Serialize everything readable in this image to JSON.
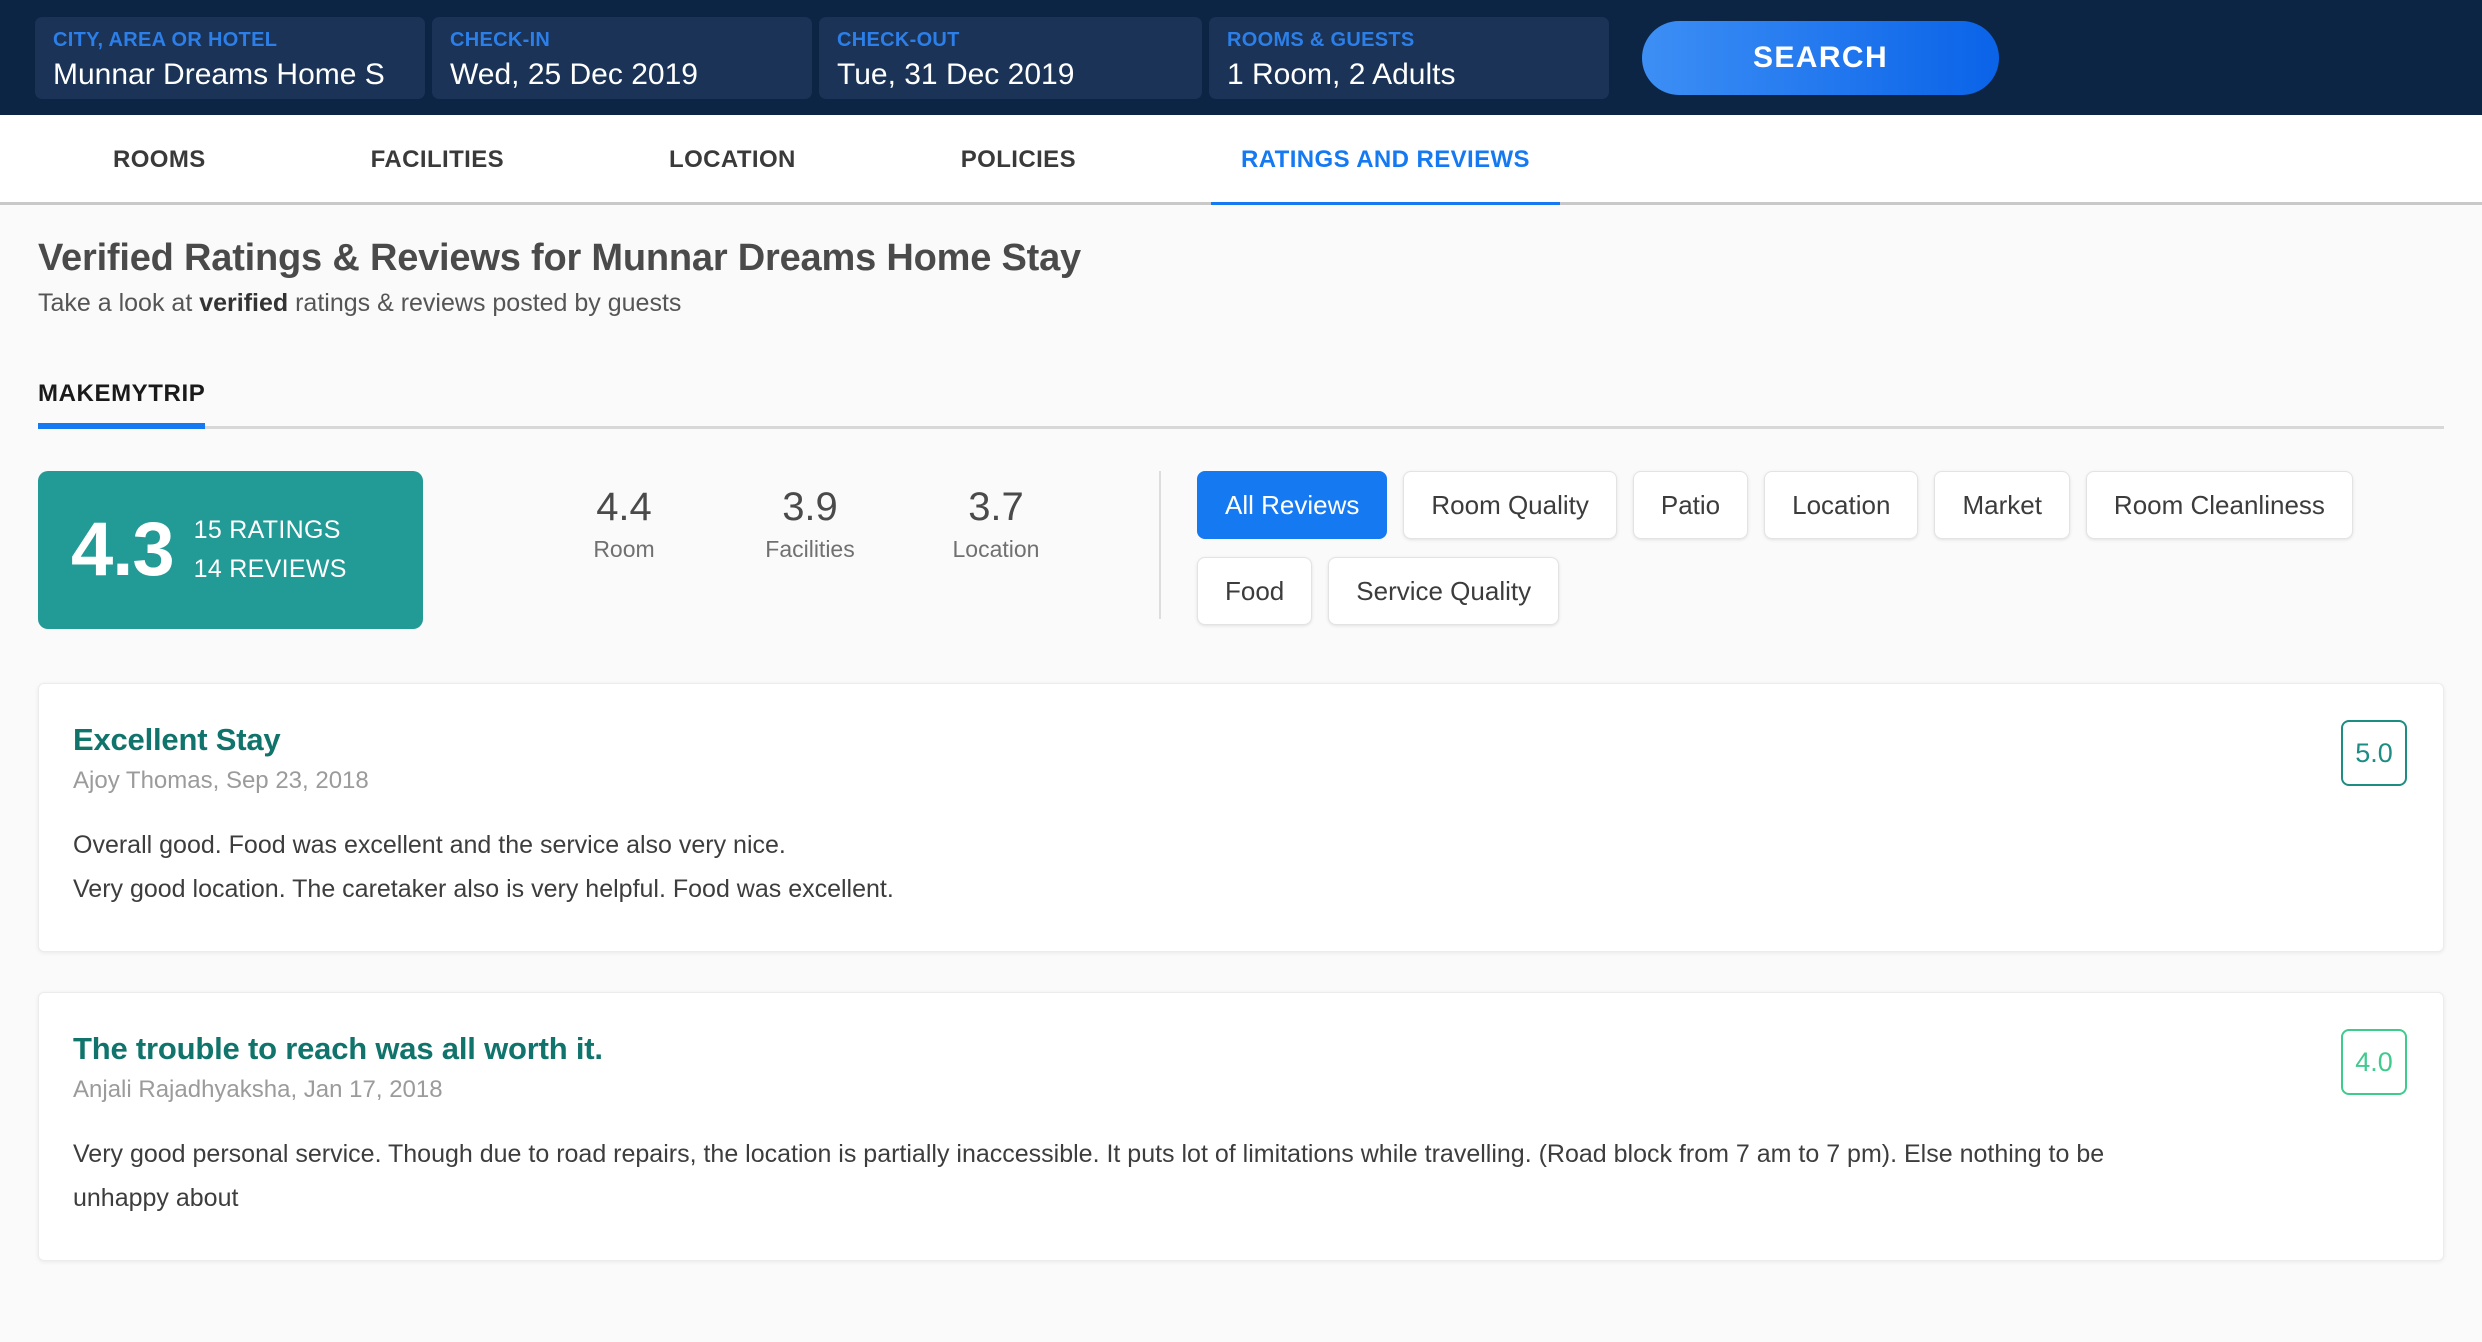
{
  "search": {
    "fields": [
      {
        "label": "CITY, AREA OR HOTEL",
        "value": "Munnar Dreams Home S"
      },
      {
        "label": "CHECK-IN",
        "value": "Wed, 25 Dec 2019"
      },
      {
        "label": "CHECK-OUT",
        "value": "Tue, 31 Dec 2019"
      },
      {
        "label": "ROOMS & GUESTS",
        "value": "1 Room, 2 Adults"
      }
    ],
    "button_label": "SEARCH"
  },
  "nav": {
    "tabs": [
      {
        "label": "ROOMS",
        "active": false
      },
      {
        "label": "FACILITIES",
        "active": false
      },
      {
        "label": "LOCATION",
        "active": false
      },
      {
        "label": "POLICIES",
        "active": false
      },
      {
        "label": "RATINGS AND REVIEWS",
        "active": true
      }
    ]
  },
  "header": {
    "title": "Verified Ratings & Reviews for Munnar Dreams Home Stay",
    "subtitle_pre": "Take a look at ",
    "subtitle_bold": "verified",
    "subtitle_post": " ratings & reviews posted by guests"
  },
  "provider": {
    "tab_label": "MAKEMYTRIP"
  },
  "summary": {
    "overall_score": "4.3",
    "ratings_count": "15 RATINGS",
    "reviews_count": "14 REVIEWS",
    "subscores": [
      {
        "value": "4.4",
        "label": "Room"
      },
      {
        "value": "3.9",
        "label": "Facilities"
      },
      {
        "value": "3.7",
        "label": "Location"
      }
    ],
    "accent_teal": "#229a96",
    "accent_blue": "#1579f2"
  },
  "filters": [
    {
      "label": "All Reviews",
      "active": true
    },
    {
      "label": "Room Quality",
      "active": false
    },
    {
      "label": "Patio",
      "active": false
    },
    {
      "label": "Location",
      "active": false
    },
    {
      "label": "Market",
      "active": false
    },
    {
      "label": "Room Cleanliness",
      "active": false
    },
    {
      "label": "Food",
      "active": false
    },
    {
      "label": "Service Quality",
      "active": false
    }
  ],
  "reviews": [
    {
      "title": "Excellent Stay",
      "meta": "Ajoy Thomas, Sep 23, 2018",
      "body": "Overall good. Food was excellent and the service also very nice.\nVery good location. The caretaker also is very helpful. Food was excellent.",
      "rating": "5.0",
      "badge_style": "dark"
    },
    {
      "title": "The trouble to reach was all worth it.",
      "meta": "Anjali Rajadhyaksha, Jan 17, 2018",
      "body": "Very good personal service. Though due to road repairs, the location is partially inaccessible. It puts lot of limitations while travelling. (Road block from 7 am to 7 pm). Else nothing to be unhappy about",
      "rating": "4.0",
      "badge_style": "light"
    }
  ]
}
